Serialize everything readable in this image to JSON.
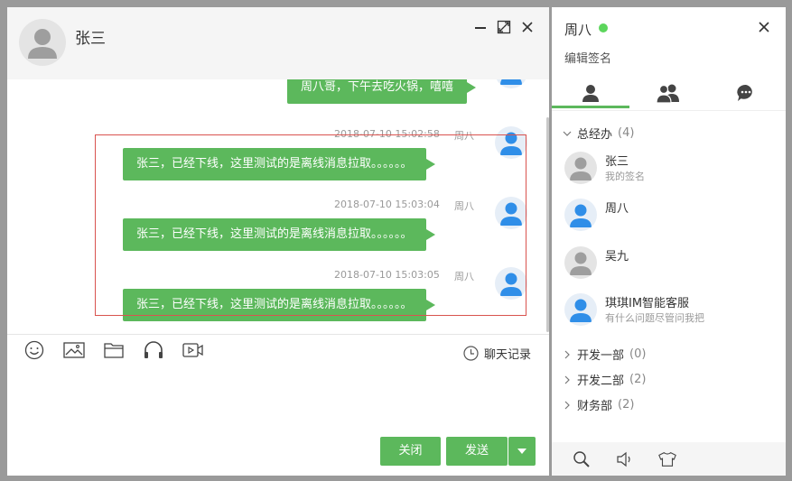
{
  "chat": {
    "title": "张三",
    "partial_message": {
      "text": "周八哥，下午去吃火锅，嘻嘻"
    },
    "messages": [
      {
        "time": "2018-07-10 15:02:58",
        "sender": "周八",
        "text": "张三，已经下线，这里测试的是离线消息拉取。。。。。。"
      },
      {
        "time": "2018-07-10 15:03:04",
        "sender": "周八",
        "text": "张三，已经下线，这里测试的是离线消息拉取。。。。。。"
      },
      {
        "time": "2018-07-10 15:03:05",
        "sender": "周八",
        "text": "张三，已经下线，这里测试的是离线消息拉取。。。。。。"
      }
    ],
    "toolbar": {
      "icons": [
        "emoji-icon",
        "image-icon",
        "folder-icon",
        "headphones-icon",
        "video-icon"
      ],
      "history_label": "聊天记录"
    },
    "buttons": {
      "close_label": "关闭",
      "send_label": "发送"
    },
    "colors": {
      "accent": "#5cb85c",
      "highlight": "#d9534f"
    }
  },
  "side": {
    "user_name": "周八",
    "signature_edit": "编辑签名",
    "status_color": "#5cd65c",
    "tabs": [
      "person-icon",
      "group-icon",
      "chat-icon"
    ],
    "groups": [
      {
        "name": "总经办",
        "count": "(4)",
        "expanded": true,
        "members": [
          {
            "name": "张三",
            "sign": "我的签名",
            "online": false
          },
          {
            "name": "周八",
            "sign": "",
            "online": true
          },
          {
            "name": "吴九",
            "sign": "",
            "online": false
          },
          {
            "name": "琪琪IM智能客服",
            "sign": "有什么问题尽管问我把",
            "online": true
          }
        ]
      },
      {
        "name": "开发一部",
        "count": "(0)",
        "expanded": false
      },
      {
        "name": "开发二部",
        "count": "(2)",
        "expanded": false
      },
      {
        "name": "财务部",
        "count": "(2)",
        "expanded": false
      }
    ],
    "footer_icons": [
      "search-icon",
      "speaker-icon",
      "shirt-icon"
    ]
  }
}
